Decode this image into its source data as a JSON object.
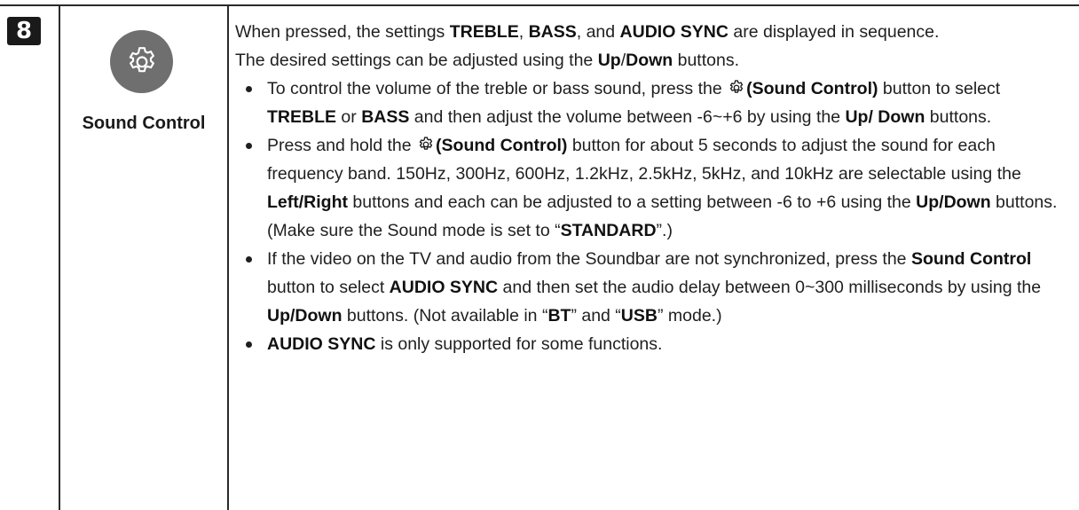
{
  "row": {
    "number": "8",
    "button_label": "Sound Control",
    "button_icon": "gear-icon"
  },
  "intro": {
    "p1_a": "When pressed, the settings ",
    "p1_treble": "TREBLE",
    "p1_b": ", ",
    "p1_bass": "BASS",
    "p1_c": ", and ",
    "p1_sync": "AUDIO SYNC",
    "p1_d": " are displayed in sequence.",
    "p2_a": "The desired settings can be adjusted using the ",
    "p2_up": "Up",
    "p2_slash": "/",
    "p2_down": "Down",
    "p2_b": " buttons."
  },
  "bullets": {
    "b1": {
      "t1": "To control the volume of the treble or bass sound, press the ",
      "t2": "(Sound Control)",
      "t3": " button to select ",
      "t4": "TREBLE",
      "t5": " or ",
      "t6": "BASS",
      "t7": " and then adjust the volume between -6~+6 by using the ",
      "t8": "Up/ Down",
      "t9": " buttons."
    },
    "b2": {
      "t1": "Press and hold the ",
      "t2": "(Sound Control)",
      "t3": " button for about 5 seconds to adjust the sound for each frequency band. 150Hz, 300Hz, 600Hz, 1.2kHz, 2.5kHz, 5kHz, and 10kHz are selectable using the ",
      "t4": "Left/Right",
      "t5": " buttons and each can be adjusted to a setting between -6 to +6 using the ",
      "t6": "Up/Down",
      "t7": " buttons. (Make sure the Sound mode is set to “",
      "t8": "STANDARD",
      "t9": "”.)"
    },
    "b3": {
      "t1": "If the video on the TV and audio from the Soundbar are not synchronized, press the ",
      "t2": "Sound Control",
      "t3": " button to select ",
      "t4": "AUDIO SYNC",
      "t5": " and then set the audio delay between 0~300 milliseconds by using the ",
      "t6": "Up/Down",
      "t7": " buttons. (Not available in “",
      "t8": "BT",
      "t9": "” and “",
      "t10": "USB",
      "t11": "” mode.)"
    },
    "b4": {
      "t1": "AUDIO SYNC",
      "t2": " is only supported for some functions."
    }
  }
}
